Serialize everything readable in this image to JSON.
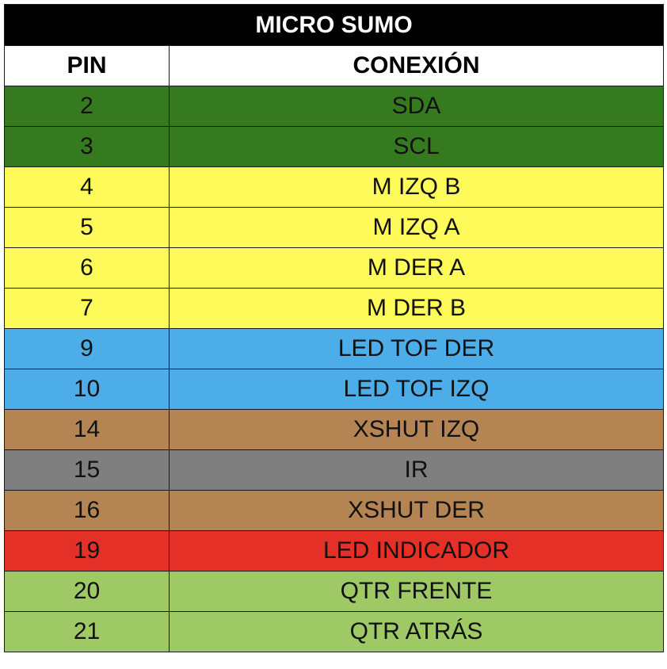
{
  "table": {
    "title": "MICRO SUMO",
    "headers": {
      "pin": "PIN",
      "connection": "CONEXIÓN"
    },
    "rows": [
      {
        "pin": "2",
        "connection": "SDA",
        "color": "#367a20"
      },
      {
        "pin": "3",
        "connection": "SCL",
        "color": "#367a20"
      },
      {
        "pin": "4",
        "connection": "M IZQ B",
        "color": "#fdfa59"
      },
      {
        "pin": "5",
        "connection": "M IZQ A",
        "color": "#fdfa59"
      },
      {
        "pin": "6",
        "connection": "M DER A",
        "color": "#fdfa59"
      },
      {
        "pin": "7",
        "connection": "M DER B",
        "color": "#fdfa59"
      },
      {
        "pin": "9",
        "connection": "LED TOF DER",
        "color": "#4cade8"
      },
      {
        "pin": "10",
        "connection": "LED TOF IZQ",
        "color": "#4cade8"
      },
      {
        "pin": "14",
        "connection": "XSHUT IZQ",
        "color": "#b48552"
      },
      {
        "pin": "15",
        "connection": "IR",
        "color": "#7f7f7f"
      },
      {
        "pin": "16",
        "connection": "XSHUT DER",
        "color": "#b48552"
      },
      {
        "pin": "19",
        "connection": "LED INDICADOR",
        "color": "#e43027"
      },
      {
        "pin": "20",
        "connection": "QTR FRENTE",
        "color": "#9ec964"
      },
      {
        "pin": "21",
        "connection": "QTR ATRÁS",
        "color": "#9ec964"
      }
    ]
  }
}
